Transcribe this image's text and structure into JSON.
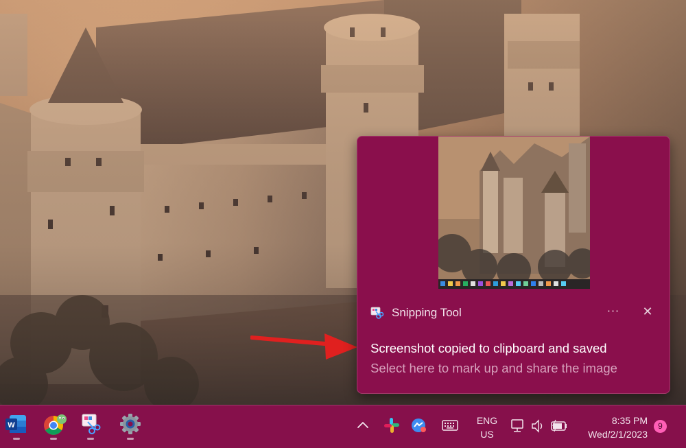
{
  "notification": {
    "app_name": "Snipping Tool",
    "more_label": "···",
    "close_label": "✕",
    "headline": "Screenshot copied to clipboard and saved",
    "subline": "Select here to mark up and share the image"
  },
  "taskbar": {
    "pinned_apps": [
      {
        "name": "Microsoft Word",
        "icon": "word-icon"
      },
      {
        "name": "Google Chrome",
        "icon": "chrome-icon"
      },
      {
        "name": "Snipping Tool",
        "icon": "snipping-tool-icon"
      },
      {
        "name": "Settings",
        "icon": "settings-gear-icon"
      }
    ],
    "language_line1": "ENG",
    "language_line2": "US",
    "time": "8:35 PM",
    "date": "Wed/2/1/2023",
    "notification_count": "9"
  },
  "colors": {
    "accent": "#86104b",
    "toast_background": "#8a0f4c",
    "arrow": "#e0201f",
    "badge": "#ff5fb6"
  }
}
